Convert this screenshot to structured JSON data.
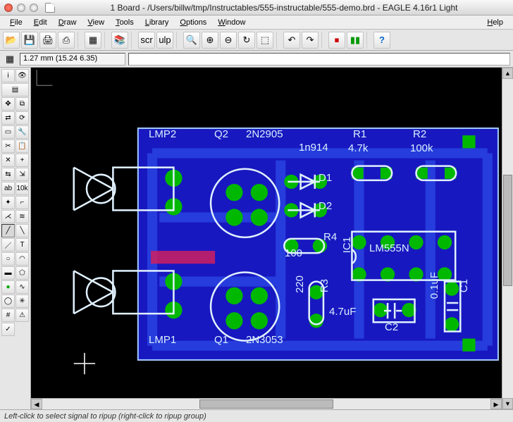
{
  "window": {
    "title": "1 Board - /Users/billw/tmp/Instructables/555-instructable/555-demo.brd - EAGLE 4.16r1 Light"
  },
  "menu": {
    "file": "File",
    "edit": "Edit",
    "draw": "Draw",
    "view": "View",
    "tools": "Tools",
    "library": "Library",
    "options": "Options",
    "window": "Window",
    "help": "Help"
  },
  "coords": "1.27 mm (15.24 6.35)",
  "status": "Left-click to select signal to ripup (right-click to ripup group)",
  "components": {
    "lmp2": "LMP2",
    "lmp1": "LMP1",
    "q2": "Q2",
    "q2val": "2N2905",
    "q1": "Q1",
    "q1val": "2N3053",
    "r1": "R1",
    "r1val": "4.7k",
    "r2": "R2",
    "r2val": "100k",
    "r3": "R3",
    "r3val": "4.7uF",
    "r3val2": "220",
    "r4": "R4",
    "r4val": "100",
    "d1": "D1",
    "d2": "D2",
    "dval": "1n914",
    "ic1": "IC1",
    "ic1val": "LM555N",
    "c1": "C1",
    "c1val": "0.1uF",
    "c2": "C2"
  }
}
